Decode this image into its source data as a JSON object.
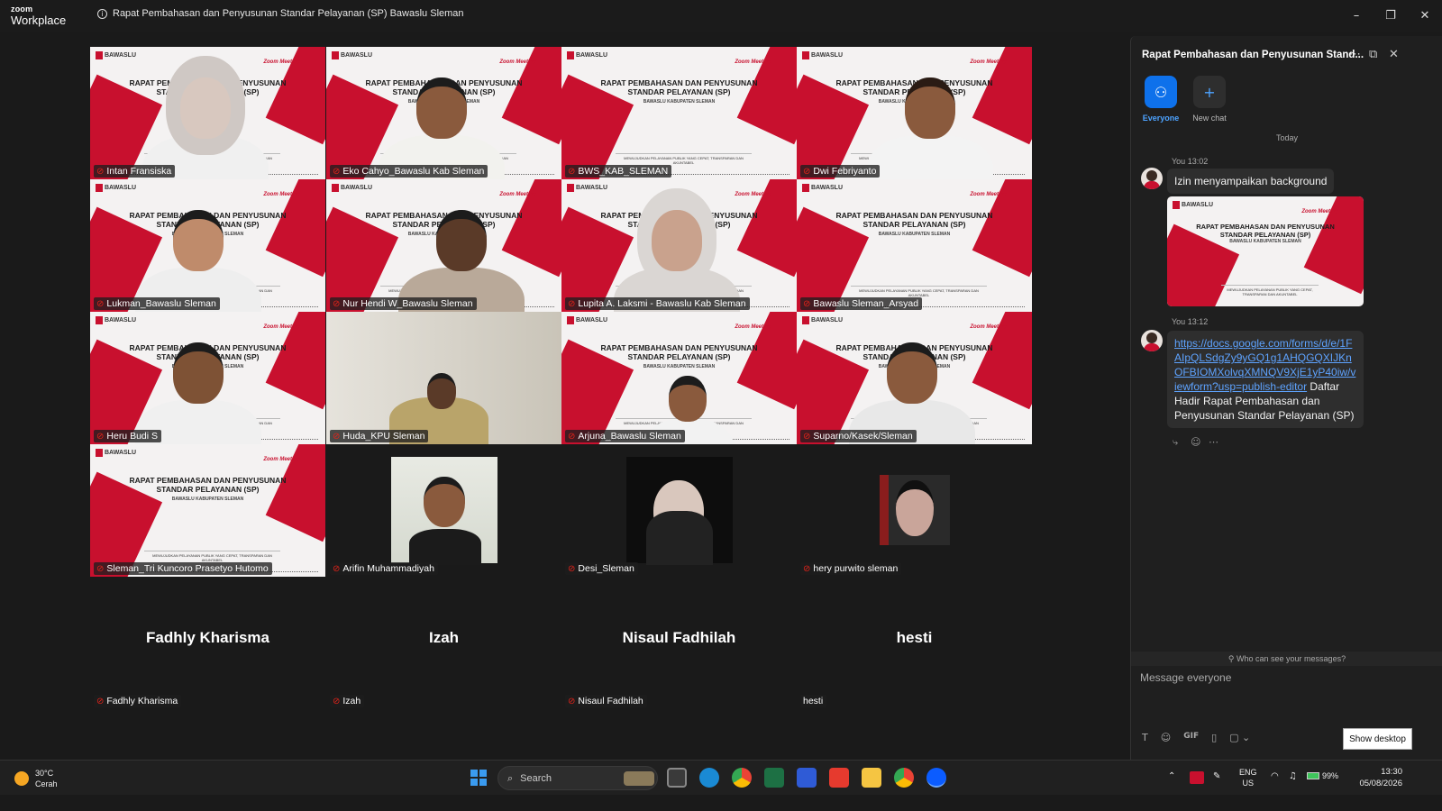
{
  "window": {
    "brand_top": "zoom",
    "brand_bottom": "Workplace",
    "meeting_title": "Rapat Pembahasan dan Penyusunan Standar Pelayanan (SP) Bawaslu Sleman",
    "controls": [
      "–",
      "❐",
      "✕"
    ]
  },
  "slide": {
    "org": "BAWASLU",
    "zoom_tag": "Zoom Meeting",
    "heading": "RAPAT PEMBAHASAN DAN PENYUSUNAN STANDAR PELAYANAN (SP)",
    "subheading": "BAWASLU KABUPATEN SLEMAN",
    "footer": "MEWUJUDKAN PELAYANAN PUBLIK YANG CEPAT, TRANSPARAN DAN AKUNTABEL"
  },
  "participants": [
    {
      "name": "Intan Fransiska"
    },
    {
      "name": "Eko Cahyo_Bawaslu Kab Sleman"
    },
    {
      "name": "BWS_KAB_SLEMAN"
    },
    {
      "name": "Dwi Febriyanto"
    },
    {
      "name": "Lukman_Bawaslu Sleman"
    },
    {
      "name": "Nur Hendi W_Bawaslu Sleman"
    },
    {
      "name": "Lupita A. Laksmi - Bawaslu Kab Sleman"
    },
    {
      "name": "Bawaslu Sleman_Arsyad"
    },
    {
      "name": "Heru Budi S"
    },
    {
      "name": "Huda_KPU Sleman"
    },
    {
      "name": "Arjuna_Bawaslu Sleman"
    },
    {
      "name": "Suparno/Kasek/Sleman"
    },
    {
      "name": "Sleman_Tri Kuncoro Prasetyo Hutomo"
    },
    {
      "name": "Arifin Muhammadiyah"
    },
    {
      "name": "Desi_Sleman"
    },
    {
      "name": "hery purwito sleman"
    },
    {
      "name": "Fadhly Kharisma"
    },
    {
      "name": "Izah"
    },
    {
      "name": "Nisaul Fadhilah"
    },
    {
      "name": "hesti"
    }
  ],
  "chat": {
    "title": "Rapat Pembahasan dan Penyusunan Stand...",
    "tab_everyone": "Everyone",
    "tab_new_chat": "New chat",
    "day_label": "Today",
    "msg1_meta": "You 13:02",
    "msg1_text": "Izin menyampaikan background",
    "msg2_meta": "You 13:12",
    "msg2_link": "https://docs.google.com/forms/d/e/1FAIpQLSdgZy9yGQ1g1AHQGQXIJKnOFBIOMXolvqXMNQV9XjE1yP40iw/viewform?usp=publish-editor",
    "msg2_text": "Daftar Hadir Rapat Pembahasan dan Penyusunan Standar Pelayanan (SP)",
    "who_can_see": "Who can see your messages?",
    "input_placeholder": "Message everyone",
    "gif_label": "GIF"
  },
  "show_desktop": "Show desktop",
  "taskbar": {
    "temp": "30°C",
    "weather": "Cerah",
    "search_label": "Search",
    "lang_top": "ENG",
    "lang_bottom": "US",
    "battery": "99%",
    "time": "13:30",
    "date": "05/08/2026"
  },
  "colors": {
    "active_speaker": "#2fd46a",
    "mic_muted": "#e2231a",
    "link": "#5ea3ff",
    "tab_active": "#0e71eb",
    "bawaslu_red": "#c8102e"
  }
}
